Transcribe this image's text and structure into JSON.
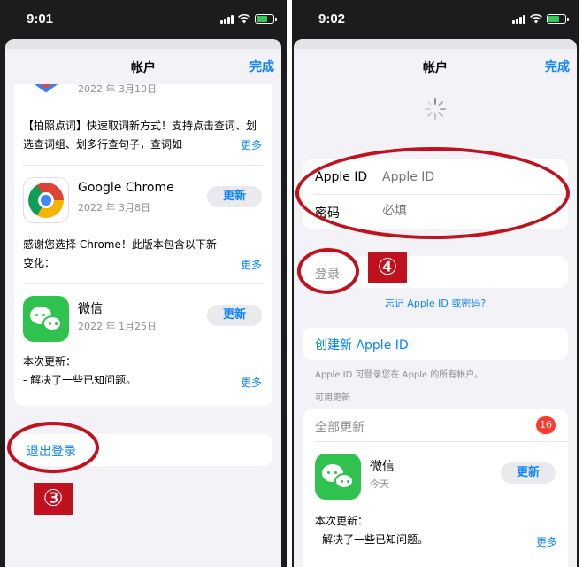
{
  "left": {
    "status_time": "9:01",
    "nav": {
      "title": "帐户",
      "done": "完成"
    },
    "apps": [
      {
        "date": "2022 年 3月10日",
        "notes": "【拍照点词】快速取词新方式！支持点击查词、划选查词组、划多行查句子，查词如",
        "more": "更多"
      },
      {
        "name": "Google Chrome",
        "date": "2022 年 3月8日",
        "update": "更新",
        "notes": "感谢您选择 Chrome！此版本包含以下新变化：",
        "more": "更多"
      },
      {
        "name": "微信",
        "date": "2022 年 1月25日",
        "update": "更新",
        "notes_line1": "本次更新：",
        "notes_line2": "- 解决了一些已知问题。",
        "more": "更多"
      }
    ],
    "sign_out": "退出登录",
    "annotation": "③",
    "annotation_color": "#c0111e"
  },
  "right": {
    "status_time": "9:02",
    "nav": {
      "title": "帐户",
      "done": "完成"
    },
    "apple_id_label": "Apple ID",
    "apple_id_placeholder": "Apple ID",
    "password_label": "密码",
    "password_placeholder": "必填",
    "sign_in": "登录",
    "annotation": "④",
    "forgot": "忘记 Apple ID 或密码?",
    "create": "创建新 Apple ID",
    "footer_note": "Apple ID 可登录您在 Apple 的所有帐户。",
    "section_header": "可用更新",
    "all_updates": "全部更新",
    "all_updates_count": "16",
    "wechat": {
      "name": "微信",
      "date": "今天",
      "update": "更新",
      "notes_line1": "本次更新：",
      "notes_line2": "- 解决了一些已知问题。",
      "more": "更多"
    }
  },
  "colors": {
    "accent": "#0a84ff",
    "annotation_red": "#c0111e",
    "wechat_green": "#2fc24f"
  }
}
